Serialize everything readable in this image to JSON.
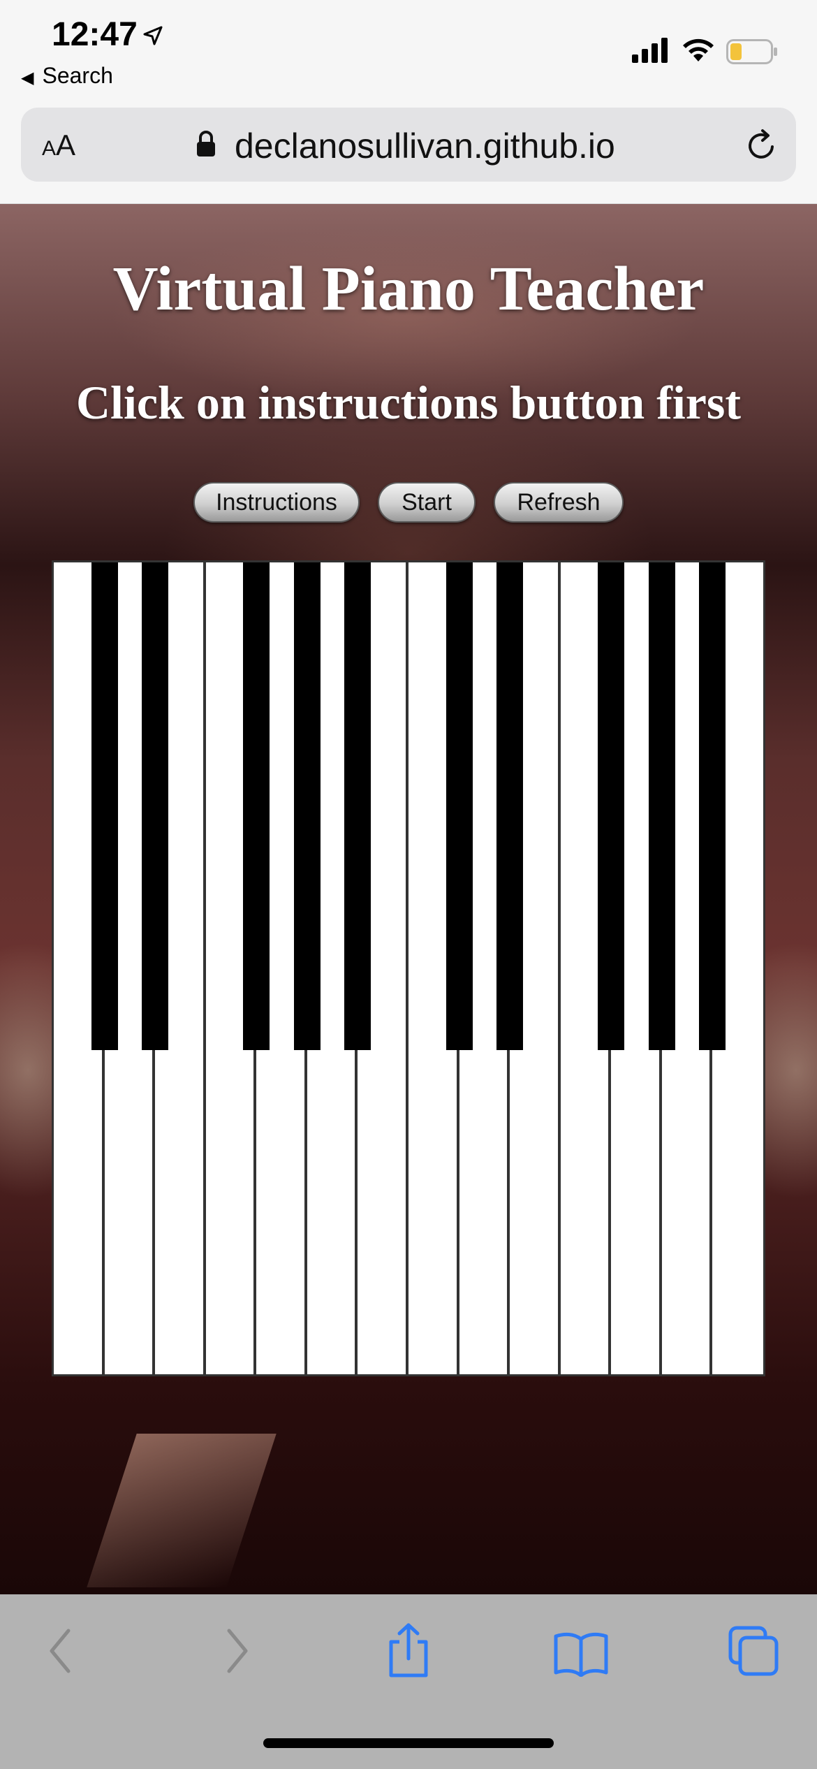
{
  "status_bar": {
    "time": "12:47",
    "back_label": "Search"
  },
  "browser": {
    "text_size_label_small": "A",
    "text_size_label_large": "A",
    "url": "declanosullivan.github.io"
  },
  "page": {
    "title": "Virtual Piano Teacher",
    "subtitle": "Click on instructions button first",
    "buttons": {
      "instructions": "Instructions",
      "start": "Start",
      "refresh": "Refresh"
    }
  },
  "keyboard": {
    "white_key_count": 14,
    "black_key_count": 10
  },
  "colors": {
    "accent_blue": "#2f7bf5",
    "toolbar_disabled": "#8a8a8a",
    "battery_level": "#f3c33b"
  },
  "toolbar": {
    "icons": [
      "back-icon",
      "forward-icon",
      "share-icon",
      "bookmarks-icon",
      "tabs-icon"
    ]
  }
}
